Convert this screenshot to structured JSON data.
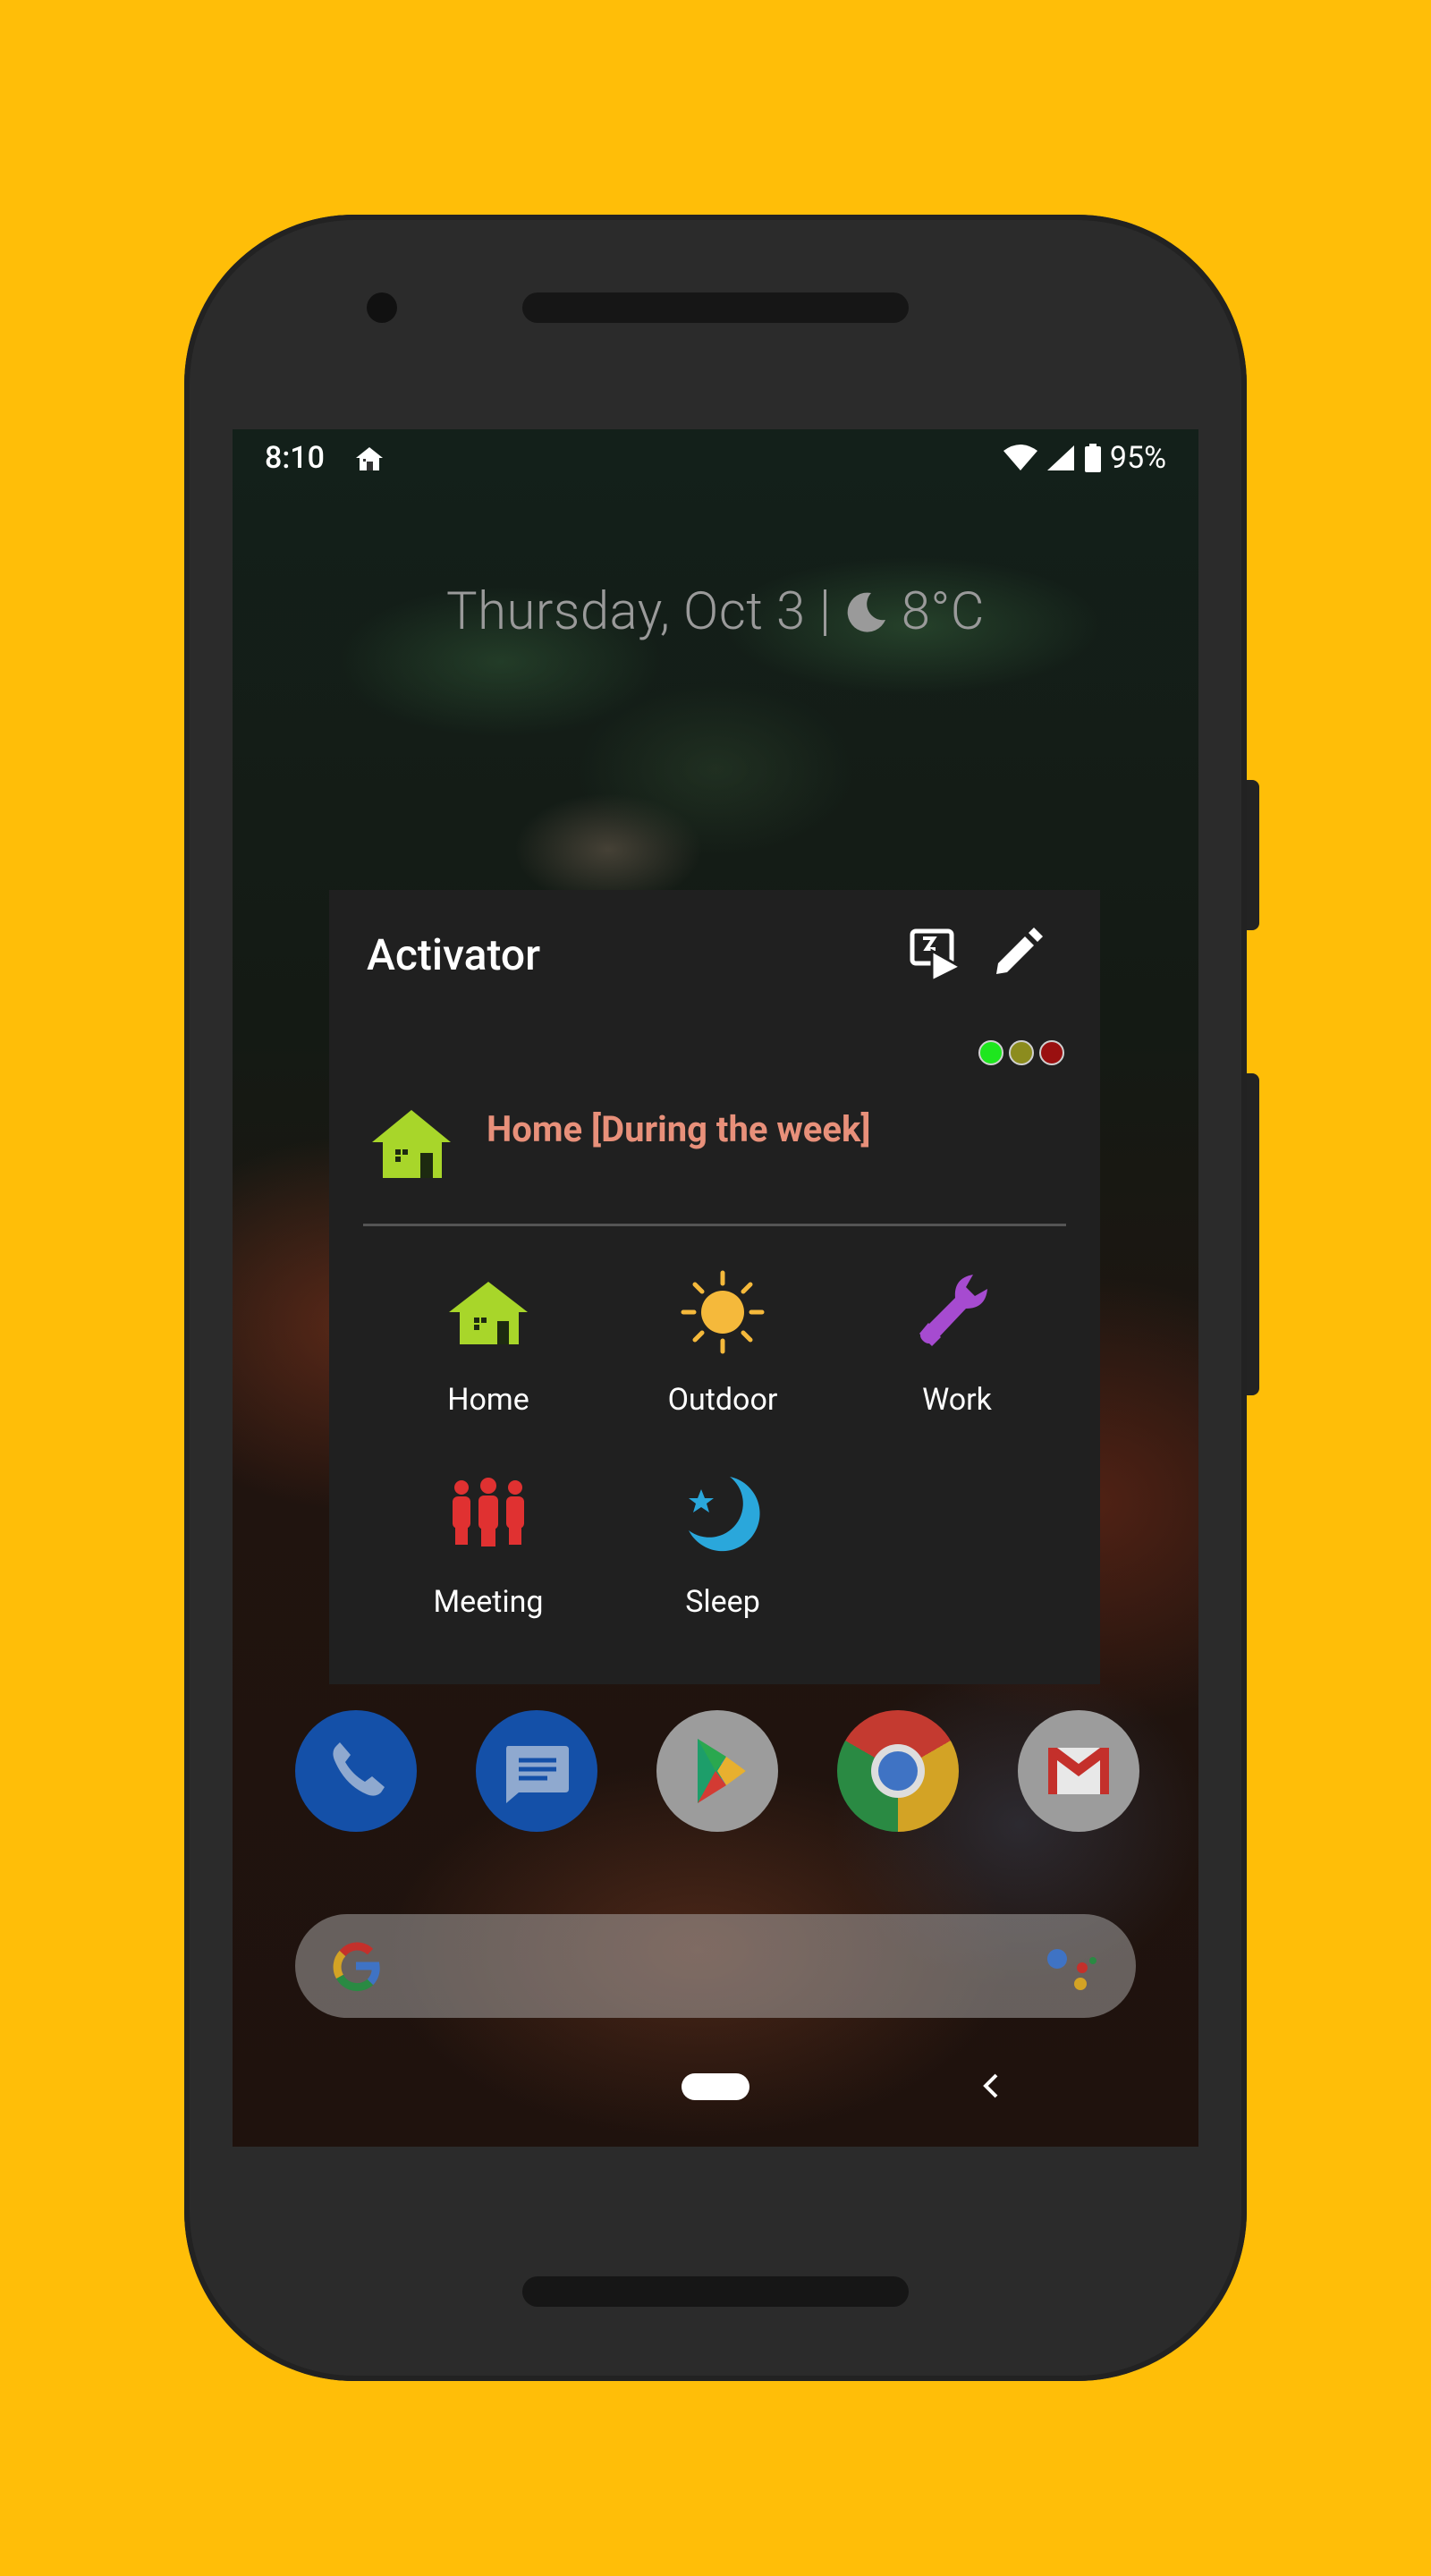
{
  "status_bar": {
    "time": "8:10",
    "battery": "95%"
  },
  "lockscreen": {
    "date": "Thursday, Oct 3",
    "temperature": "8°C"
  },
  "widget": {
    "title": "Activator",
    "status_dots": [
      "#1EE61E",
      "#8C8C1E",
      "#9A1010"
    ],
    "current_profile": {
      "name": "Home [During the week]",
      "color": "#E8907A"
    },
    "profiles": [
      {
        "label": "Home",
        "icon": "house-icon",
        "color": "#A8D62A"
      },
      {
        "label": "Outdoor",
        "icon": "sun-icon",
        "color": "#F5B93B"
      },
      {
        "label": "Work",
        "icon": "wrench-icon",
        "color": "#A64BD0"
      },
      {
        "label": "Meeting",
        "icon": "people-icon",
        "color": "#E03131"
      },
      {
        "label": "Sleep",
        "icon": "moon-star-icon",
        "color": "#2AA7DB"
      }
    ]
  },
  "dock": [
    "phone-app",
    "messages-app",
    "play-store-app",
    "chrome-app",
    "gmail-app"
  ]
}
